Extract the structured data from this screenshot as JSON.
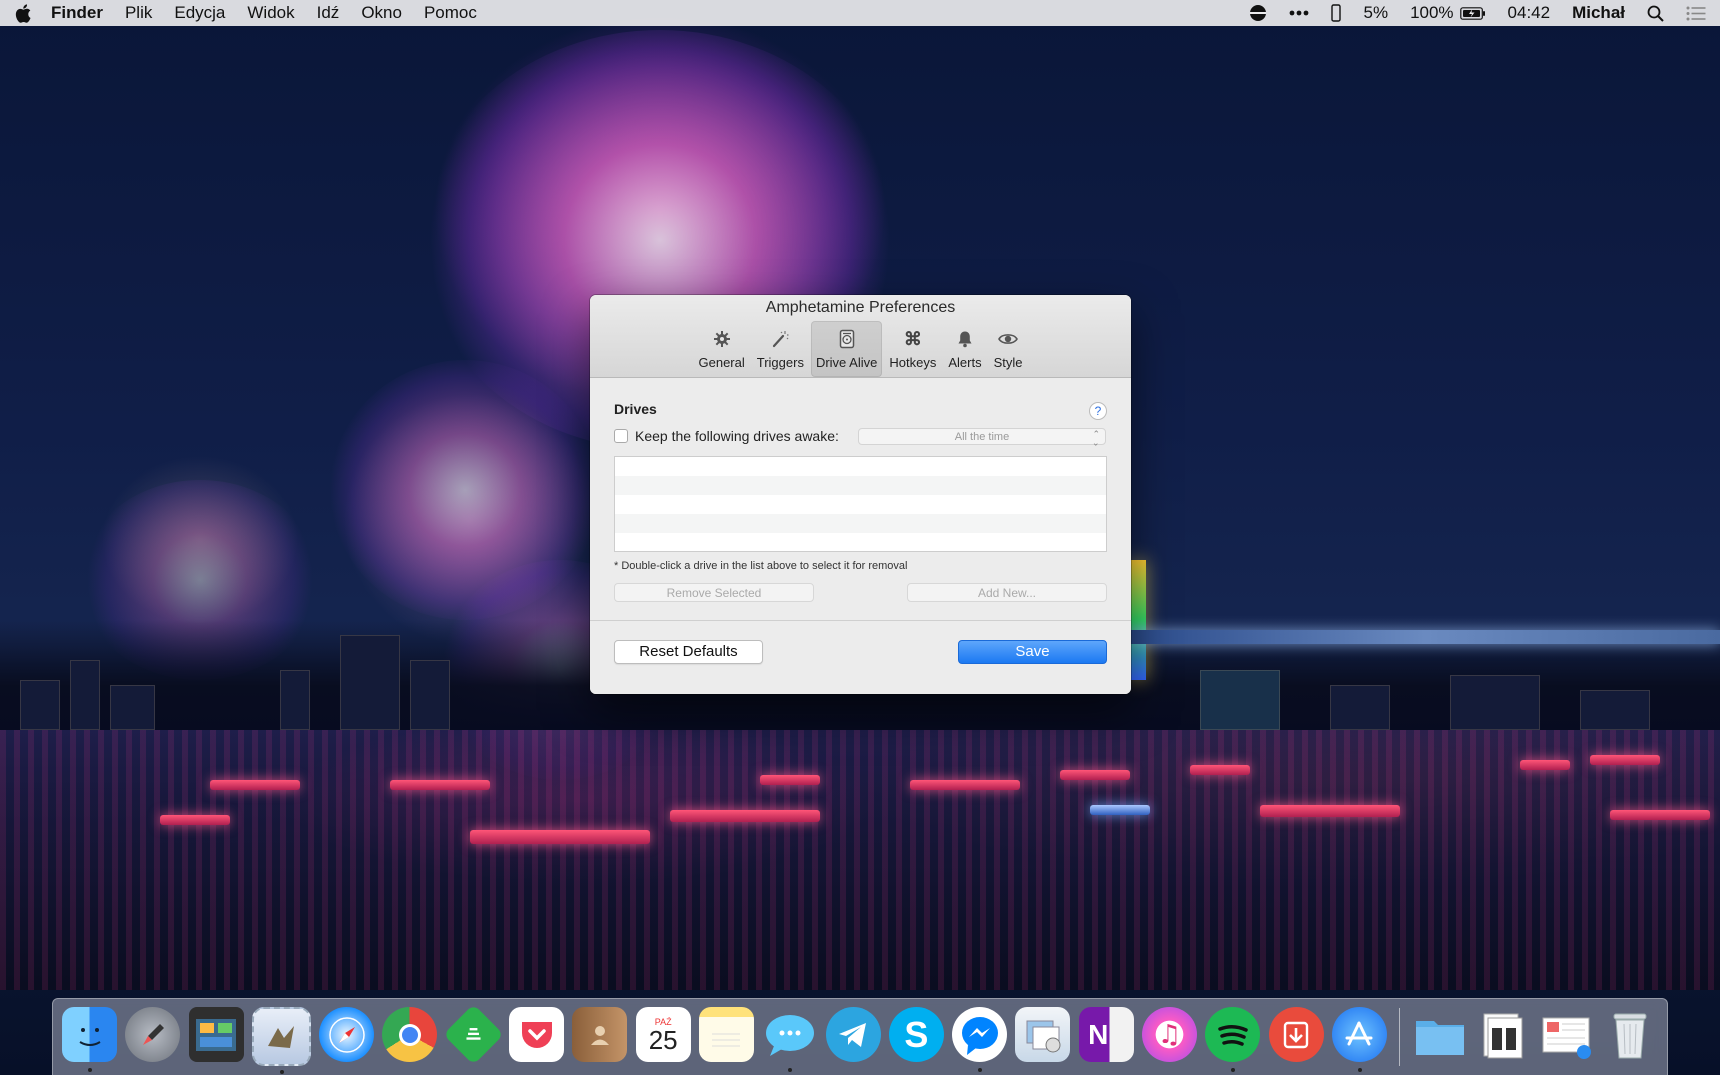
{
  "menubar": {
    "app_name": "Finder",
    "menus": [
      "Plik",
      "Edycja",
      "Widok",
      "Idź",
      "Okno",
      "Pomoc"
    ],
    "status": {
      "cpu": "5%",
      "battery": "100%",
      "time": "04:42",
      "user": "Michał"
    },
    "icons": [
      "apple-icon",
      "vpn-icon",
      "more-icon",
      "phone-icon",
      "battery-icon",
      "spotlight-icon",
      "notification-center-icon"
    ]
  },
  "window": {
    "title": "Amphetamine Preferences",
    "tabs": [
      {
        "label": "General",
        "icon": "gear-icon"
      },
      {
        "label": "Triggers",
        "icon": "magic-wand-icon"
      },
      {
        "label": "Drive Alive",
        "icon": "hard-drive-icon",
        "selected": true
      },
      {
        "label": "Hotkeys",
        "icon": "command-icon"
      },
      {
        "label": "Alerts",
        "icon": "bell-icon"
      },
      {
        "label": "Style",
        "icon": "eye-icon"
      }
    ],
    "drives": {
      "section_title": "Drives",
      "help": "?",
      "keep_awake_label": "Keep the following drives awake:",
      "keep_awake_checked": false,
      "schedule_select": "All the time",
      "note": "* Double-click a drive in the list above to select it for removal",
      "remove_button": "Remove Selected",
      "add_button": "Add New..."
    },
    "reset_button": "Reset Defaults",
    "save_button": "Save"
  },
  "dock": {
    "apps": [
      {
        "name": "Finder",
        "icon": "finder-icon",
        "color": "#3a9cf5",
        "running": true
      },
      {
        "name": "Launchpad",
        "icon": "launchpad-icon",
        "color": "#8a8f99",
        "running": false
      },
      {
        "name": "Mission Control",
        "icon": "mission-control-icon",
        "color": "#2f2f2f",
        "running": false
      },
      {
        "name": "Mail",
        "icon": "mail-icon",
        "color": "#c8d8ef",
        "running": true
      },
      {
        "name": "Safari",
        "icon": "safari-icon",
        "color": "#1e90ff",
        "running": false
      },
      {
        "name": "Chrome",
        "icon": "chrome-icon",
        "color": "#e8453c",
        "running": false
      },
      {
        "name": "Feedly",
        "icon": "feedly-icon",
        "color": "#2bb24c",
        "running": false
      },
      {
        "name": "Pocket",
        "icon": "pocket-icon",
        "color": "#ef4056",
        "running": false
      },
      {
        "name": "Contacts",
        "icon": "contacts-icon",
        "color": "#b98a5e",
        "running": false
      },
      {
        "name": "Calendar",
        "icon": "calendar-icon",
        "color": "#ffffff",
        "month": "PAŹ",
        "day": "25",
        "running": false
      },
      {
        "name": "Notes",
        "icon": "notes-icon",
        "color": "#ffe680",
        "running": false
      },
      {
        "name": "Messages",
        "icon": "messages-icon",
        "color": "#5ac8fa",
        "running": true
      },
      {
        "name": "Telegram",
        "icon": "telegram-icon",
        "color": "#2ca5e0",
        "running": false
      },
      {
        "name": "Skype",
        "icon": "skype-icon",
        "color": "#00aff0",
        "running": false
      },
      {
        "name": "Messenger",
        "icon": "messenger-icon",
        "color": "#0084ff",
        "running": true
      },
      {
        "name": "Preview",
        "icon": "preview-icon",
        "color": "#d6e4f0",
        "running": false
      },
      {
        "name": "OneNote",
        "icon": "onenote-icon",
        "color": "#7719aa",
        "running": false
      },
      {
        "name": "iTunes",
        "icon": "itunes-icon",
        "color": "#fb5bc5",
        "running": false
      },
      {
        "name": "Spotify",
        "icon": "spotify-icon",
        "color": "#1db954",
        "running": true
      },
      {
        "name": "Transmit",
        "icon": "download-icon",
        "color": "#e94b3c",
        "running": false
      },
      {
        "name": "App Store",
        "icon": "app-store-icon",
        "color": "#1a8cff",
        "running": true
      }
    ],
    "stacks": [
      {
        "name": "Downloads",
        "icon": "folder-icon",
        "color": "#6cb7f0"
      },
      {
        "name": "Documents",
        "icon": "documents-stack-icon",
        "color": "#e8e8e8"
      },
      {
        "name": "Screenshots",
        "icon": "screenshots-stack-icon",
        "color": "#f0f0f0"
      },
      {
        "name": "Trash",
        "icon": "trash-icon",
        "color": "#cfd4da"
      }
    ]
  }
}
